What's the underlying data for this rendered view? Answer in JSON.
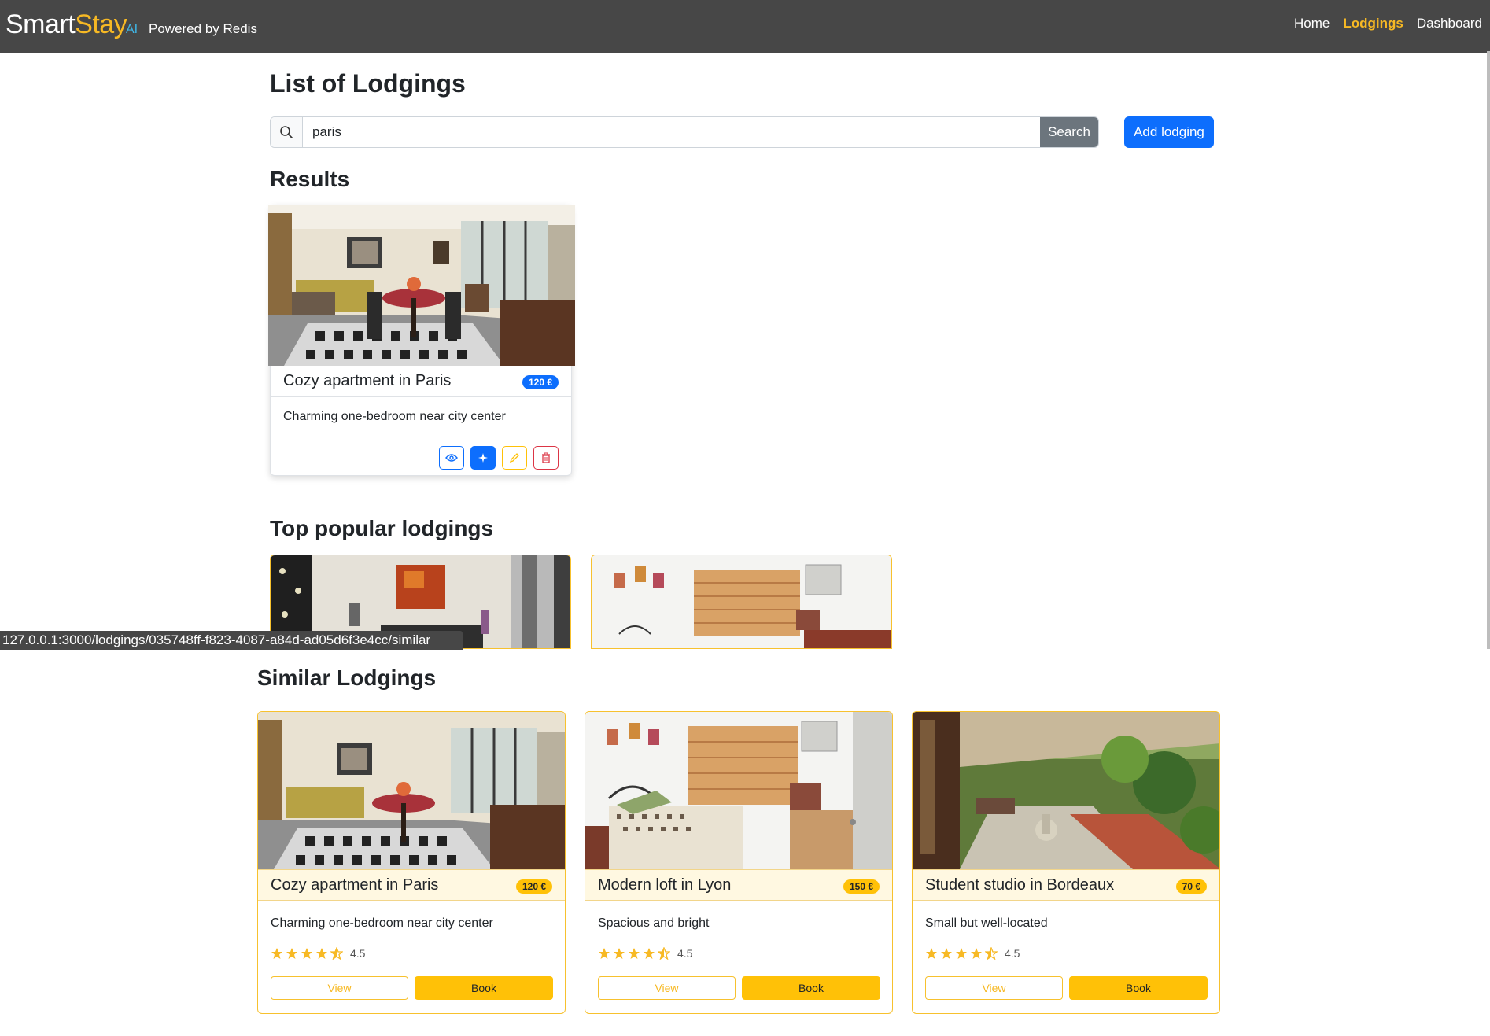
{
  "nav": {
    "brand_start": "Smart",
    "brand_end": "Stay",
    "ai_tag": "AI",
    "powered": "Powered by Redis",
    "links": [
      "Home",
      "Lodgings",
      "Dashboard"
    ],
    "active": "Lodgings"
  },
  "page": {
    "title": "List of Lodgings",
    "search_value": "paris",
    "search_button": "Search",
    "add_button": "Add lodging",
    "results_heading": "Results",
    "popular_heading": "Top popular lodgings",
    "similar_heading": "Similar Lodgings"
  },
  "result": {
    "title": "Cozy apartment in Paris",
    "price": "120 €",
    "description": "Charming one-bedroom near city center",
    "actions": [
      "eye-icon",
      "sparkle-icon",
      "pencil-icon",
      "trash-icon"
    ]
  },
  "status_url": "127.0.0.1:3000/lodgings/035748ff-f823-4087-a84d-ad05d6f3e4cc/similar",
  "similar": [
    {
      "title": "Cozy apartment in Paris",
      "price": "120 €",
      "description": "Charming one-bedroom near city center",
      "rating": "4.5",
      "view": "View",
      "book": "Book"
    },
    {
      "title": "Modern loft in Lyon",
      "price": "150 €",
      "description": "Spacious and bright",
      "rating": "4.5",
      "view": "View",
      "book": "Book"
    },
    {
      "title": "Student studio in Bordeaux",
      "price": "70 €",
      "description": "Small but well-located",
      "rating": "4.5",
      "view": "View",
      "book": "Book"
    }
  ],
  "colors": {
    "navbar": "#474747",
    "accent_yellow": "#f7b924",
    "primary_blue": "#0d6efd",
    "danger": "#dc3545",
    "warning": "#ffc107"
  }
}
